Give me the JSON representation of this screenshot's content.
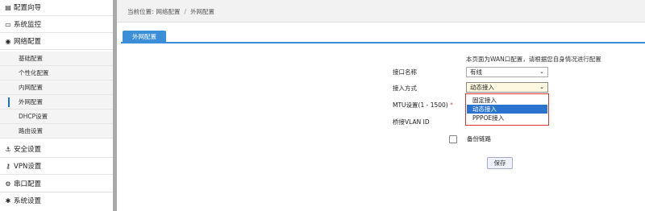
{
  "sidebar": {
    "items": [
      {
        "label": "配置向导",
        "icon": "list-icon"
      },
      {
        "label": "系统监控",
        "icon": "monitor-icon"
      },
      {
        "label": "网络配置",
        "icon": "globe-icon"
      },
      {
        "label": "安全设置",
        "icon": "anchor-icon"
      },
      {
        "label": "VPN设置",
        "icon": "key-icon"
      },
      {
        "label": "串口配置",
        "icon": "gears-icon"
      },
      {
        "label": "系统设置",
        "icon": "gear-icon"
      }
    ],
    "subitems": [
      {
        "label": "基础配置"
      },
      {
        "label": "个性化配置"
      },
      {
        "label": "内网配置"
      },
      {
        "label": "外网配置",
        "active": true
      },
      {
        "label": "DHCP设置"
      },
      {
        "label": "路由设置"
      }
    ]
  },
  "breadcrumb": {
    "prefix": "当前位置:",
    "section": "网络配置",
    "separator": "/",
    "page": "外网配置"
  },
  "tab": {
    "label": "外网配置"
  },
  "form": {
    "note": "本页面为WAN口配置，请根据您自身情况进行配置",
    "interface_name": {
      "label": "接口名称",
      "value": "有线"
    },
    "access_mode": {
      "label": "接入方式",
      "value": "动态接入",
      "options": [
        "固定接入",
        "动态接入",
        "PPPOE接入"
      ],
      "selected_index": 1
    },
    "mtu": {
      "label": "MTU设置(1 - 1500)",
      "required_mark": "*"
    },
    "vlan": {
      "label": "桥接VLAN ID"
    },
    "backup_link": {
      "label": "备份链路",
      "checked": false
    },
    "save_label": "保存"
  },
  "colors": {
    "accent": "#3a8fd8",
    "selected": "#2a73cf",
    "highlight_border": "#d33333"
  }
}
